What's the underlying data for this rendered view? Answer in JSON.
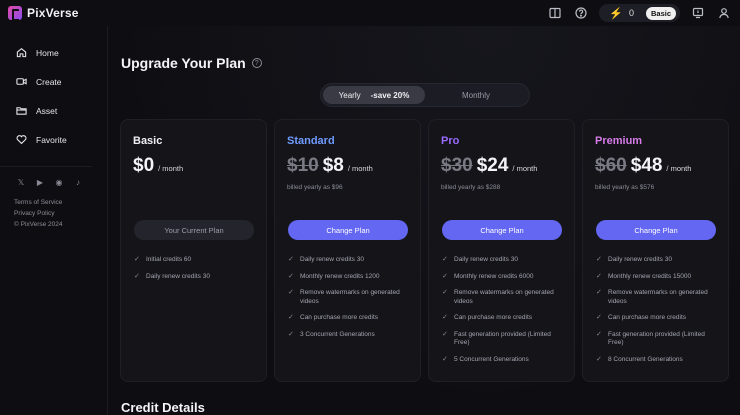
{
  "brand": {
    "name": "PixVerse"
  },
  "topbar": {
    "credits": "0",
    "plan_badge": "Basic"
  },
  "sidebar": {
    "items": [
      {
        "label": "Home",
        "icon": "home-icon"
      },
      {
        "label": "Create",
        "icon": "video-camera-icon"
      },
      {
        "label": "Asset",
        "icon": "folder-icon"
      },
      {
        "label": "Favorite",
        "icon": "heart-icon"
      }
    ],
    "socials": [
      "x-icon",
      "youtube-icon",
      "discord-icon",
      "tiktok-icon"
    ],
    "legal": [
      "Terms of Service",
      "Privacy Policy",
      "© PixVerse 2024"
    ]
  },
  "page": {
    "title": "Upgrade Your Plan",
    "toggle": {
      "yearly": "Yearly",
      "save": "-save 20%",
      "monthly": "Monthly"
    },
    "section2_title": "Credit Details"
  },
  "colors": {
    "accent": "#6467f2",
    "standard": "#6f9bff",
    "pro": "#9a6bff",
    "premium": "#d67be8"
  },
  "plans": [
    {
      "name": "Basic",
      "old_price": "",
      "price": "$0",
      "per": "/ month",
      "billed": "",
      "cta": "Your Current Plan",
      "features": [
        "Initial credits 60",
        "Daily renew credits 30"
      ]
    },
    {
      "name": "Standard",
      "old_price": "$10",
      "price": "$8",
      "per": "/ month",
      "billed": "billed yearly as $96",
      "cta": "Change Plan",
      "features": [
        "Daily renew credits 30",
        "Monthly renew credits 1200",
        "Remove watermarks on generated videos",
        "Can purchase more credits",
        "3 Concurrent Generations"
      ]
    },
    {
      "name": "Pro",
      "old_price": "$30",
      "price": "$24",
      "per": "/ month",
      "billed": "billed yearly as $288",
      "cta": "Change Plan",
      "features": [
        "Daily renew credits 30",
        "Monthly renew credits 6000",
        "Remove watermarks on generated videos",
        "Can purchase more credits",
        "Fast generation provided (Limited Free)",
        "5 Concurrent Generations"
      ]
    },
    {
      "name": "Premium",
      "old_price": "$60",
      "price": "$48",
      "per": "/ month",
      "billed": "billed yearly as $576",
      "cta": "Change Plan",
      "features": [
        "Daily renew credits 30",
        "Monthly renew credits 15000",
        "Remove watermarks on generated videos",
        "Can purchase more credits",
        "Fast generation provided (Limited Free)",
        "8 Concurrent Generations"
      ]
    }
  ]
}
